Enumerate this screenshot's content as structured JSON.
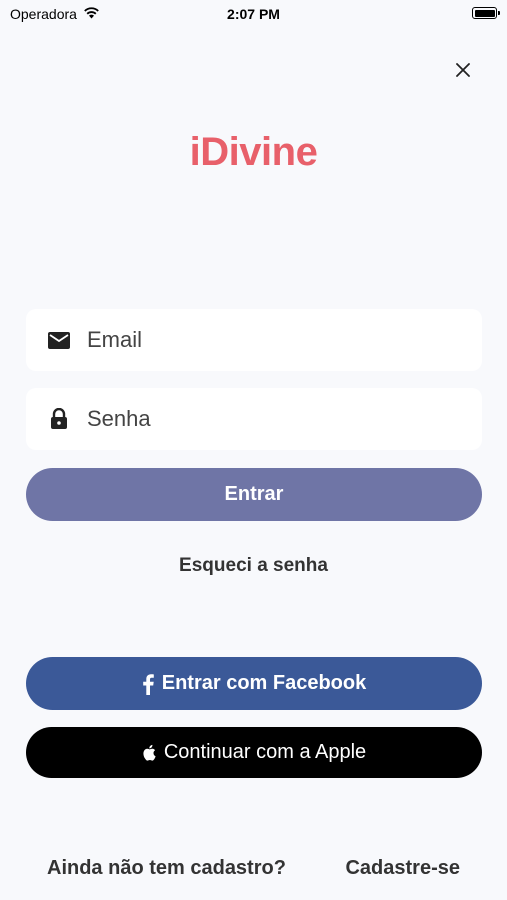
{
  "status_bar": {
    "carrier": "Operadora",
    "time": "2:07 PM"
  },
  "header": {
    "logo_text": "iDivine",
    "close_icon": "close-icon"
  },
  "form": {
    "email_placeholder": "Email",
    "email_value": "",
    "email_icon": "envelope-icon",
    "password_placeholder": "Senha",
    "password_value": "",
    "password_icon": "lock-icon",
    "login_label": "Entrar",
    "forgot_label": "Esqueci a senha"
  },
  "social": {
    "facebook_label": "Entrar com Facebook",
    "facebook_icon": "facebook-icon",
    "apple_label": "Continuar com a Apple",
    "apple_icon": "apple-icon"
  },
  "footer": {
    "question": "Ainda não tem cadastro?",
    "signup_label": "Cadastre-se"
  },
  "colors": {
    "brand": "#e8606a",
    "login_button": "#6f75a6",
    "facebook": "#3b5998",
    "apple": "#000000",
    "background": "#f8f9fc"
  }
}
